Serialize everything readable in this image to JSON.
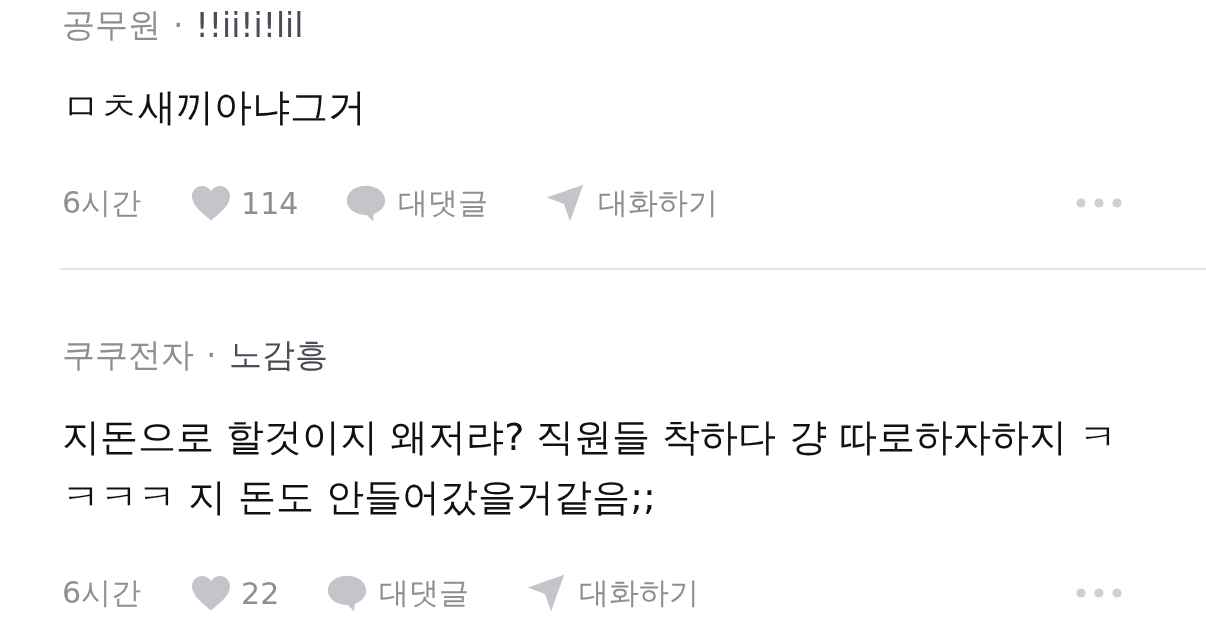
{
  "comments": [
    {
      "company": "공무원",
      "separator": "·",
      "author": "!!ii!i!lil",
      "body": "ㅁㅊ새끼아냐그거",
      "time": "6시간",
      "likes": "114",
      "reply_label": "대댓글",
      "chat_label": "대화하기"
    },
    {
      "company": "쿠쿠전자",
      "separator": "·",
      "author": "노감흥",
      "body": "지돈으로 할것이지 왜저랴? 직원들 착하다 걍 따로하자하지 ㅋㅋㅋㅋ 지 돈도 안들어갔을거같음;;",
      "time": "6시간",
      "likes": "22",
      "reply_label": "대댓글",
      "chat_label": "대화하기"
    }
  ]
}
